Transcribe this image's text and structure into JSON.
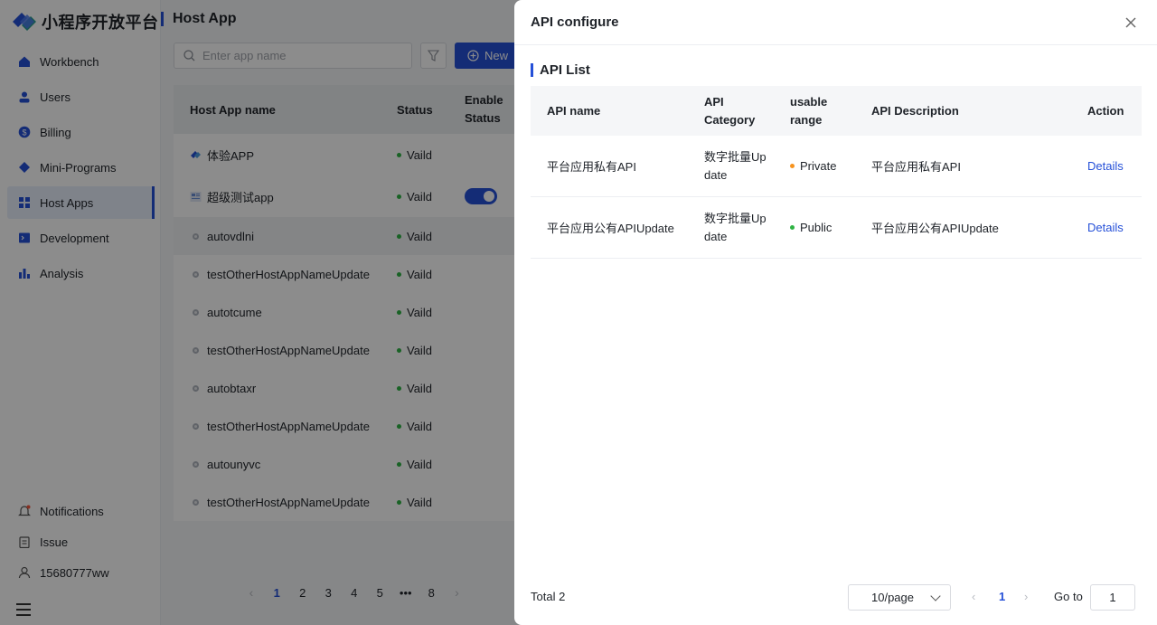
{
  "brand": {
    "name": "小程序开放平台",
    "accent": "#2550d8"
  },
  "sidebar": {
    "items": [
      {
        "label": "Workbench",
        "icon": "home-icon"
      },
      {
        "label": "Users",
        "icon": "user-icon"
      },
      {
        "label": "Billing",
        "icon": "billing-icon"
      },
      {
        "label": "Mini-Programs",
        "icon": "diamond-icon"
      },
      {
        "label": "Host Apps",
        "icon": "grid-icon",
        "active": true
      },
      {
        "label": "Development",
        "icon": "monitor-icon"
      },
      {
        "label": "Analysis",
        "icon": "bar-chart-icon"
      }
    ],
    "bottom": [
      {
        "label": "Notifications",
        "icon": "bell-icon"
      },
      {
        "label": "Issue",
        "icon": "clipboard-icon"
      },
      {
        "label": "15680777ww",
        "icon": "person-icon"
      }
    ]
  },
  "main": {
    "title": "Host App",
    "search_placeholder": "Enter app name",
    "new_label": "New",
    "columns": {
      "name": "Host App name",
      "status": "Status",
      "enable": "Enable Status"
    },
    "rows": [
      {
        "name": "体验APP",
        "status": "Vaild"
      },
      {
        "name": "超级测试app",
        "status": "Vaild"
      },
      {
        "name": "autovdlni",
        "status": "Vaild"
      },
      {
        "name": "testOtherHostAppNameUpdate",
        "status": "Vaild"
      },
      {
        "name": "autotcume",
        "status": "Vaild"
      },
      {
        "name": "testOtherHostAppNameUpdate",
        "status": "Vaild"
      },
      {
        "name": "autobtaxr",
        "status": "Vaild"
      },
      {
        "name": "testOtherHostAppNameUpdate",
        "status": "Vaild"
      },
      {
        "name": "autounyvc",
        "status": "Vaild"
      },
      {
        "name": "testOtherHostAppNameUpdate",
        "status": "Vaild"
      }
    ],
    "pager": {
      "pages": [
        "1",
        "2",
        "3",
        "4",
        "5",
        "•••",
        "8"
      ],
      "current": "1"
    }
  },
  "drawer": {
    "title": "API configure",
    "section": "API List",
    "columns": {
      "name": "API name",
      "category": "API Category",
      "range": "usable range",
      "desc": "API Description",
      "action": "Action"
    },
    "rows": [
      {
        "name": "平台应用私有API",
        "category": "数字批量Update",
        "range": "Private",
        "range_color": "#f7931e",
        "desc": "平台应用私有API",
        "action": "Details"
      },
      {
        "name": "平台应用公有APIUpdate",
        "category": "数字批量Update",
        "range": "Public",
        "range_color": "#2fb344",
        "desc": "平台应用公有APIUpdate",
        "action": "Details"
      }
    ],
    "footer": {
      "total": "Total 2",
      "page_size": "10/page",
      "current_page": "1",
      "goto_label": "Go to",
      "goto_value": "1"
    }
  },
  "colors": {
    "valid_dot": "#2fb344"
  }
}
